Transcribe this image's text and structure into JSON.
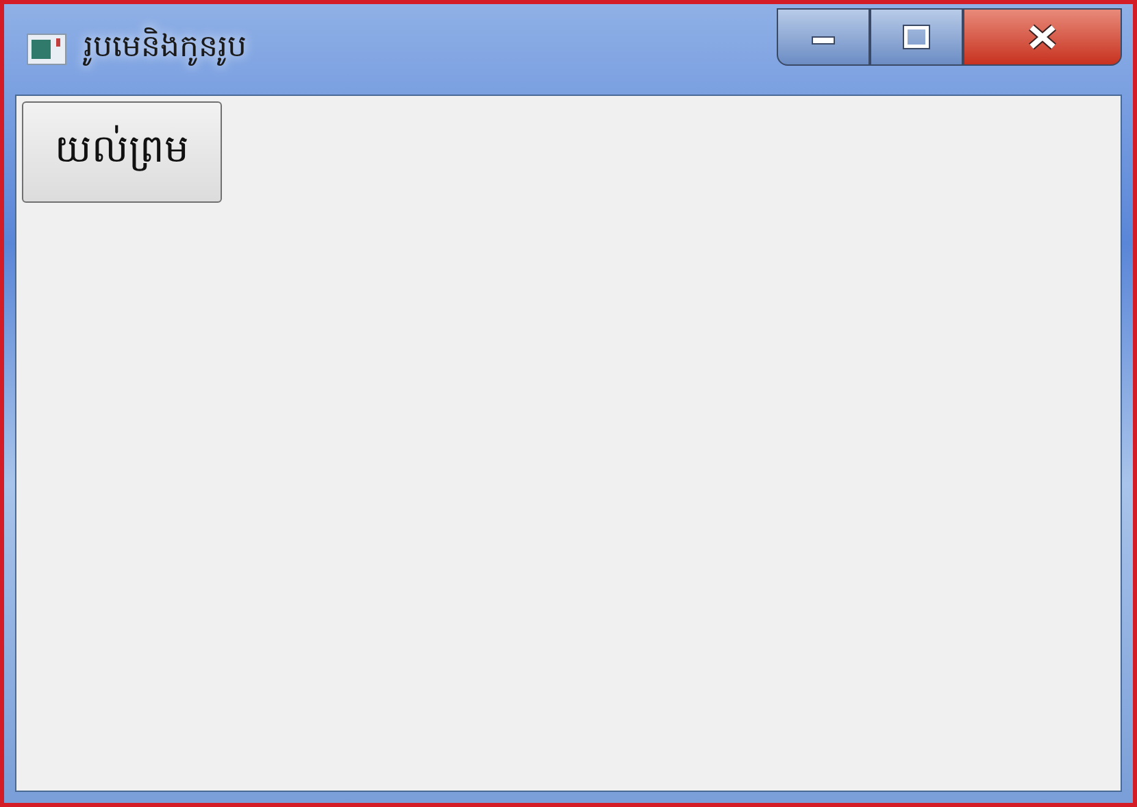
{
  "window": {
    "title": "រូបមេនិងកូនរូប"
  },
  "buttons": [
    {
      "label": "យល់ព្រម"
    }
  ]
}
